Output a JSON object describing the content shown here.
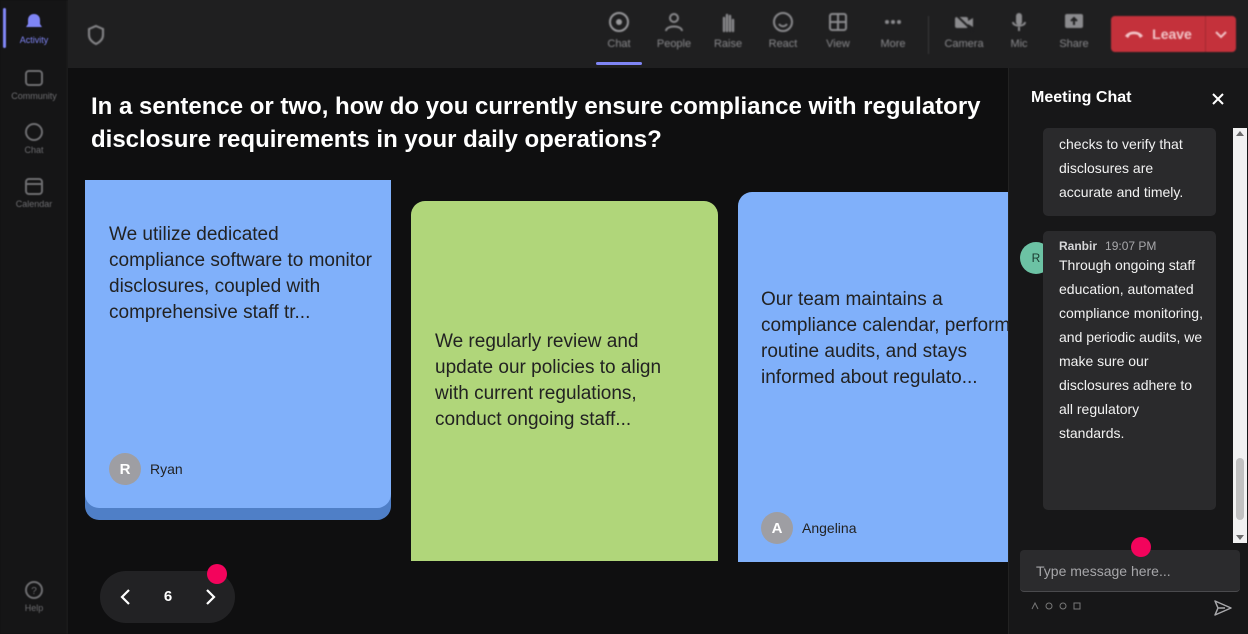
{
  "rail": {
    "items": [
      {
        "label": "Activity",
        "icon": "bell-icon"
      },
      {
        "label": "Community",
        "icon": "community-icon"
      },
      {
        "label": "Chat",
        "icon": "chat-icon"
      },
      {
        "label": "Calendar",
        "icon": "calendar-icon"
      }
    ],
    "help_label": "Help"
  },
  "toolbar": {
    "buttons": [
      {
        "label": "Chat",
        "icon": "chat-bubble-icon"
      },
      {
        "label": "People",
        "icon": "people-icon"
      },
      {
        "label": "Raise",
        "icon": "raise-hand-icon"
      },
      {
        "label": "React",
        "icon": "smiley-icon"
      },
      {
        "label": "View",
        "icon": "grid-view-icon"
      },
      {
        "label": "More",
        "icon": "more-icon"
      },
      {
        "label": "Camera",
        "icon": "camera-off-icon"
      },
      {
        "label": "Mic",
        "icon": "mic-icon"
      },
      {
        "label": "Share",
        "icon": "share-icon"
      }
    ],
    "leave_label": "Leave"
  },
  "stage": {
    "question": "In a sentence or two, how do you currently ensure compliance with regulatory disclosure requirements in your daily operations?",
    "cards": [
      {
        "text": "We utilize dedicated compliance software to monitor disclosures, coupled with comprehensive staff tr...",
        "author": "Ryan",
        "initial": "R"
      },
      {
        "text": "We regularly review and update our policies to align with current regulations, conduct ongoing staff...",
        "author": "",
        "initial": ""
      },
      {
        "text": "Our team maintains a compliance calendar, performs routine audits, and stays informed about regulato...",
        "author": "Angelina",
        "initial": "A"
      }
    ],
    "page_number": "6"
  },
  "chat": {
    "title": "Meeting Chat",
    "messages": [
      {
        "text": "checks to verify that disclosures are accurate and timely."
      },
      {
        "author": "Ranbir",
        "initial": "R",
        "time": "19:07 PM",
        "text": "Through ongoing staff education, automated compliance monitoring, and periodic audits, we make sure our disclosures adhere to all regulatory standards."
      }
    ],
    "input_placeholder": "Type message here..."
  },
  "colors": {
    "accent": "#7f85f5",
    "leave": "#c4313b",
    "card_blue": "#80b0fa",
    "card_green": "#b0d67a",
    "highlight_dot": "#f3045c"
  }
}
